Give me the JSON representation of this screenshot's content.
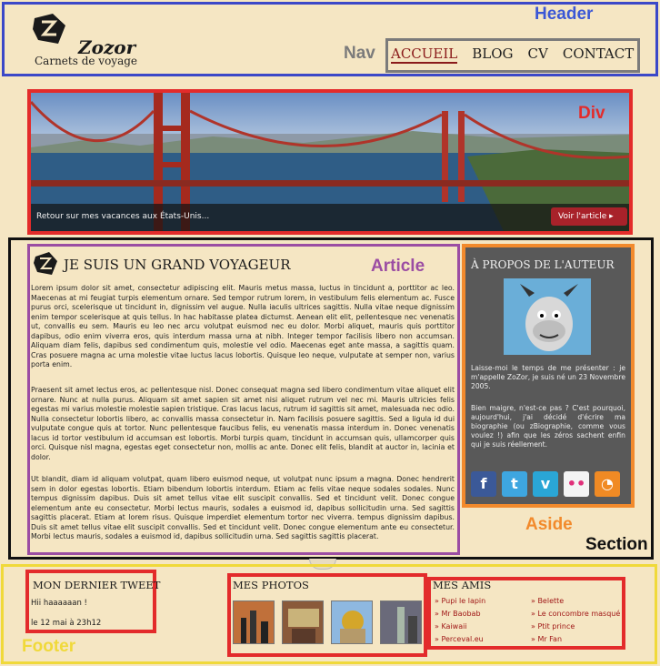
{
  "labels": {
    "header": "Header",
    "nav": "Nav",
    "div": "Div",
    "article": "Article",
    "aside": "Aside",
    "section": "Section",
    "footer": "Footer"
  },
  "logo": {
    "name": "Zozor",
    "tagline": "Carnets de voyage"
  },
  "nav": {
    "items": [
      {
        "label": "ACCUEIL"
      },
      {
        "label": "BLOG"
      },
      {
        "label": "CV"
      },
      {
        "label": "CONTACT"
      }
    ]
  },
  "banner": {
    "caption": "Retour sur mes vacances aux États-Unis...",
    "button": "Voir l'article ▸"
  },
  "article": {
    "title": "JE SUIS UN GRAND VOYAGEUR",
    "para1": "Lorem ipsum dolor sit amet, consectetur adipiscing elit. Mauris metus massa, luctus in tincidunt a, porttitor ac leo. Maecenas at mi feugiat turpis elementum ornare. Sed tempor rutrum lorem, in vestibulum felis elementum ac. Fusce purus orci, scelerisque ut tincidunt in, dignissim vel augue. Nulla iaculis ultrices sagittis. Nulla vitae neque dignissim enim tempor scelerisque at quis tellus. In hac habitasse platea dictumst. Aenean elit elit, pellentesque nec venenatis ut, convallis eu sem. Mauris eu leo nec arcu volutpat euismod nec eu dolor. Morbi aliquet, mauris quis porttitor dapibus, odio enim viverra eros, quis interdum massa urna at nibh. Integer tempor facilisis libero non accumsan. Aliquam diam felis, dapibus sed condimentum quis, molestie vel odio. Maecenas eget ante massa, a sagittis quam. Cras posuere magna ac urna molestie vitae luctus lacus lobortis. Quisque leo neque, vulputate at semper non, varius porta enim.",
    "para2": "Praesent sit amet lectus eros, ac pellentesque nisl. Donec consequat magna sed libero condimentum vitae aliquet elit ornare. Nunc at nulla purus. Aliquam sit amet sapien sit amet nisi aliquet rutrum vel nec mi. Mauris ultricies felis egestas mi varius molestie molestie sapien tristique. Cras lacus lacus, rutrum id sagittis sit amet, malesuada nec odio. Nulla consectetur lobortis libero, ac convallis massa consectetur in. Nam facilisis posuere sagittis. Sed a ligula id dui vulputate congue quis at tortor. Nunc pellentesque faucibus felis, eu venenatis massa interdum in. Donec venenatis lacus id tortor vestibulum id accumsan est lobortis. Morbi turpis quam, tincidunt in accumsan quis, ullamcorper quis orci. Quisque nisl magna, egestas eget consectetur non, mollis ac ante. Donec elit felis, blandit at auctor in, lacinia et dolor.",
    "para3": "Ut blandit, diam id aliquam volutpat, quam libero euismod neque, ut volutpat nunc ipsum a magna. Donec hendrerit sem in dolor egestas lobortis. Etiam bibendum lobortis interdum. Etiam ac felis vitae neque sodales sodales. Nunc tempus dignissim dapibus. Duis sit amet tellus vitae elit suscipit convallis. Sed et tincidunt velit. Donec congue elementum ante eu consectetur. Morbi lectus mauris, sodales a euismod id, dapibus sollicitudin urna. Sed sagittis sagittis placerat. Etiam at lorem risus. Quisque imperdiet elementum tortor nec viverra. tempus dignissim dapibus. Duis sit amet tellus vitae elit suscipit convallis. Sed et tincidunt velit. Donec congue elementum ante eu consectetur. Morbi lectus mauris, sodales a euismod id, dapibus sollicitudin urna. Sed sagittis sagittis placerat."
  },
  "aside": {
    "title": "À PROPOS DE L'AUTEUR",
    "text1": "Laisse-moi le temps de me présenter : je m'appelle ZoZor, je suis né un 23 Novembre 2005.",
    "text2": "Bien maigre, n'est-ce pas ? C'est pourquoi, aujourd'hui, j'ai décidé d'écrire ma biographie (ou zBiographie, comme vous voulez !) afin que les zéros sachent enfin qui je suis réellement.",
    "social": [
      {
        "icon": "facebook-icon",
        "glyph": "f",
        "color": "#3b5998"
      },
      {
        "icon": "twitter-icon",
        "glyph": "t",
        "color": "#3ea6e0"
      },
      {
        "icon": "vimeo-icon",
        "glyph": "v",
        "color": "#2aa6d6"
      },
      {
        "icon": "flickr-icon",
        "glyph": "••",
        "color": "#f4f4f4"
      },
      {
        "icon": "rss-icon",
        "glyph": "◔",
        "color": "#f08a24"
      }
    ]
  },
  "footer": {
    "tweet": {
      "title": "MON DERNIER TWEET",
      "text": "Hii haaaaaan !",
      "date": "le 12 mai à 23h12"
    },
    "photos": {
      "title": "MES PHOTOS"
    },
    "friends": {
      "title": "MES AMIS",
      "col1": [
        "Pupi le lapin",
        "Mr Baobab",
        "Kaiwaii",
        "Perceval.eu"
      ],
      "col2": [
        "Belette",
        "Le concombre masqué",
        "Ptit prince",
        "Mr Fan"
      ]
    }
  }
}
